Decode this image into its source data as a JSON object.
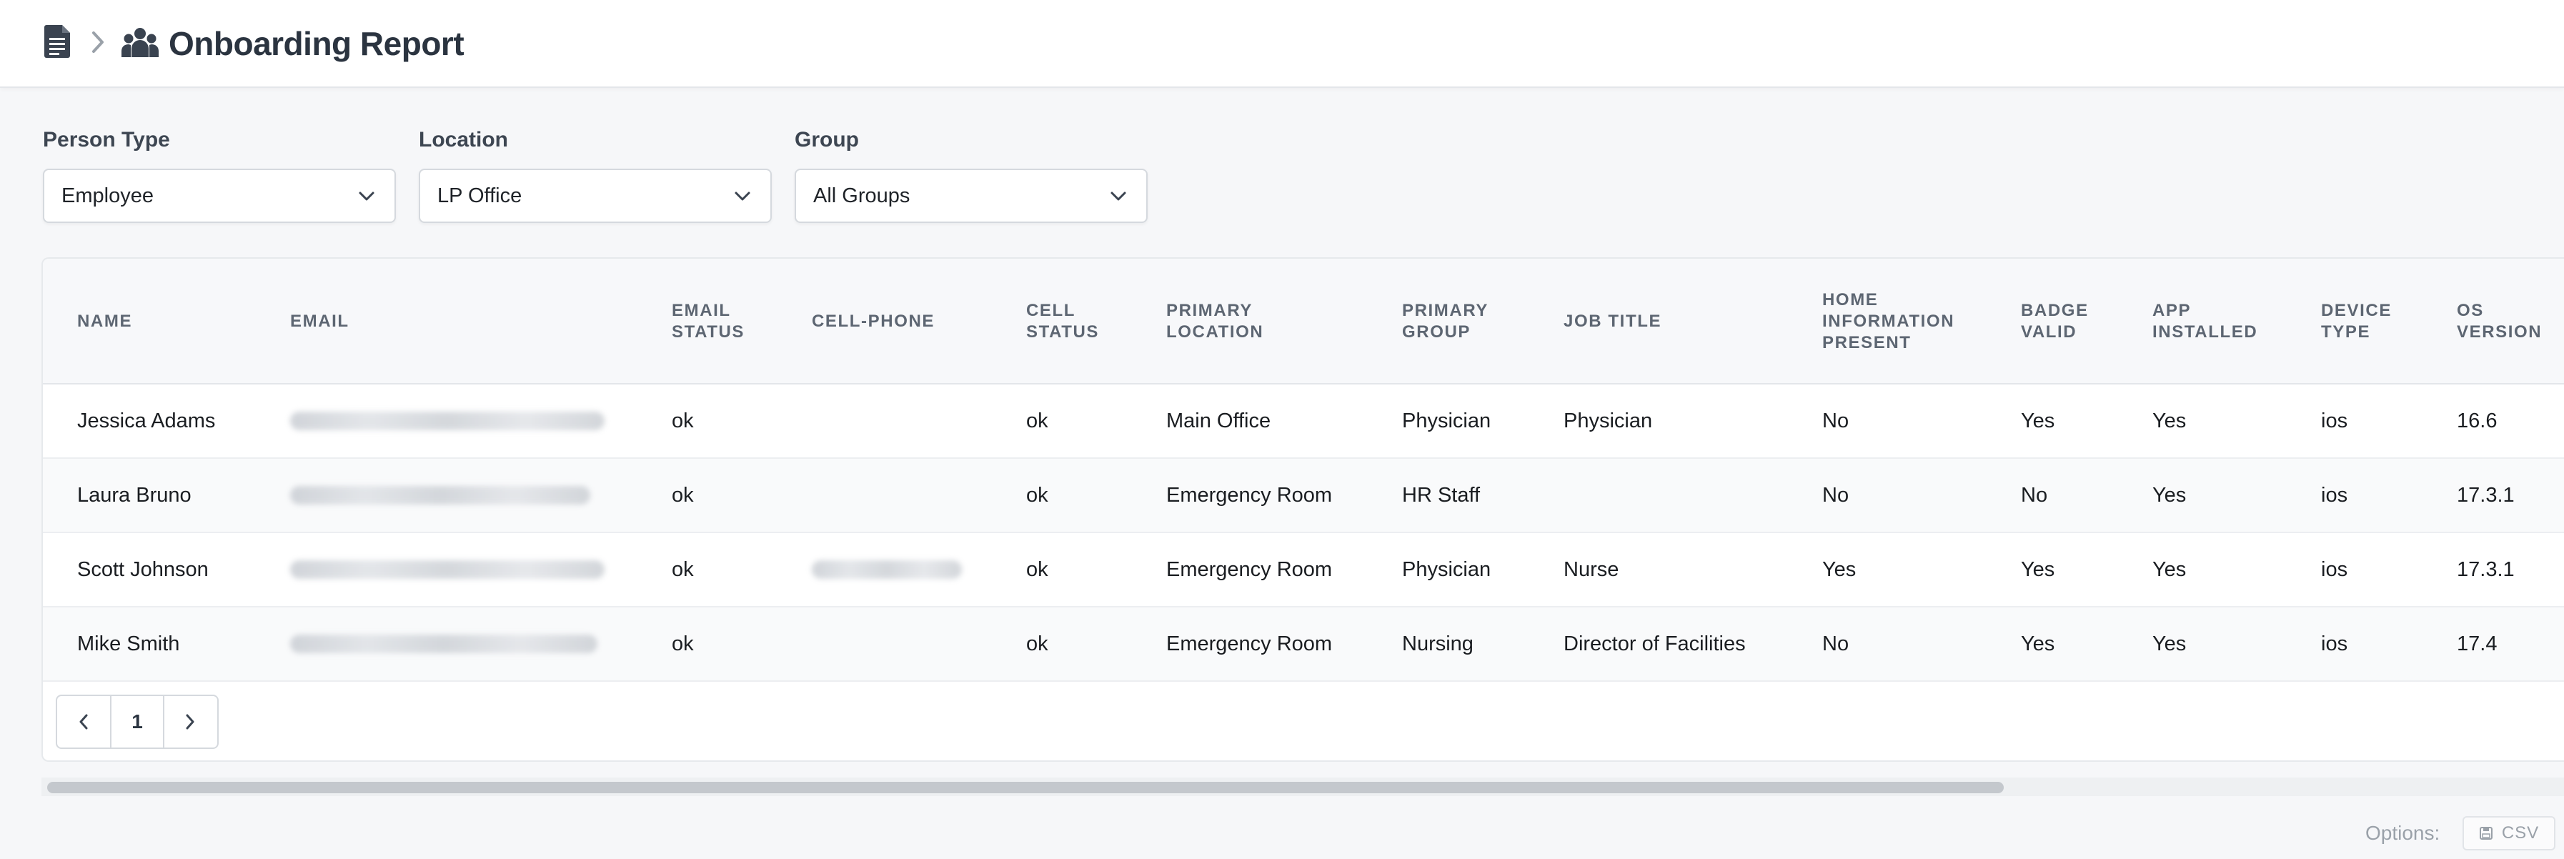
{
  "header": {
    "title": "Onboarding Report",
    "icons": [
      "document-icon",
      "chevron-right-icon",
      "people-icon"
    ]
  },
  "filters": [
    {
      "label": "Person Type",
      "value": "Employee"
    },
    {
      "label": "Location",
      "value": "LP Office"
    },
    {
      "label": "Group",
      "value": "All Groups"
    }
  ],
  "table": {
    "columns": [
      "NAME",
      "EMAIL",
      "EMAIL\nSTATUS",
      "CELL-PHONE",
      "CELL\nSTATUS",
      "PRIMARY\nLOCATION",
      "PRIMARY\nGROUP",
      "JOB TITLE",
      "HOME\nINFORMATION\nPRESENT",
      "BADGE\nVALID",
      "APP\nINSTALLED",
      "DEVICE\nTYPE",
      "OS\nVERSION"
    ],
    "rows": [
      {
        "name": "Jessica Adams",
        "email_status": "ok",
        "cell_status": "ok",
        "primary_location": "Main Office",
        "primary_group": "Physician",
        "job_title": "Physician",
        "home_info": "No",
        "badge_valid": "Yes",
        "app_installed": "Yes",
        "device_type": "ios",
        "os_version": "16.6"
      },
      {
        "name": "Laura Bruno",
        "email_status": "ok",
        "cell_status": "ok",
        "primary_location": "Emergency Room",
        "primary_group": "HR Staff",
        "job_title": "",
        "home_info": "No",
        "badge_valid": "No",
        "app_installed": "Yes",
        "device_type": "ios",
        "os_version": "17.3.1"
      },
      {
        "name": "Scott Johnson",
        "email_status": "ok",
        "cell_status": "ok",
        "primary_location": "Emergency Room",
        "primary_group": "Physician",
        "job_title": "Nurse",
        "home_info": "Yes",
        "badge_valid": "Yes",
        "app_installed": "Yes",
        "device_type": "ios",
        "os_version": "17.3.1"
      },
      {
        "name": "Mike Smith",
        "email_status": "ok",
        "cell_status": "ok",
        "primary_location": "Emergency Room",
        "primary_group": "Nursing",
        "job_title": "Director of Facilities",
        "home_info": "No",
        "badge_valid": "Yes",
        "app_installed": "Yes",
        "device_type": "ios",
        "os_version": "17.4"
      }
    ]
  },
  "pagination": {
    "current_page": "1"
  },
  "footer": {
    "options_label": "Options:",
    "csv_label": "CSV"
  }
}
